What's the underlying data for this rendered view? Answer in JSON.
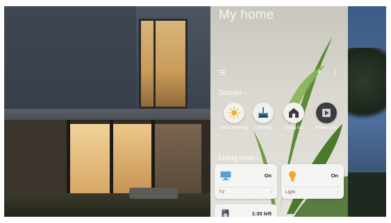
{
  "app": {
    "title": "My home"
  },
  "toolbar": {
    "menu_icon": "menu-icon",
    "add_icon": "plus-icon",
    "add_label": "+",
    "more_icon": "more-vertical-icon"
  },
  "scenes": {
    "label": "Scenes",
    "chevron": "›",
    "items": [
      {
        "label": "Good morning",
        "icon": "sun-icon"
      },
      {
        "label": "Cleaning",
        "icon": "broom-icon"
      },
      {
        "label": "Going out",
        "icon": "house-icon"
      },
      {
        "label": "Movie time",
        "icon": "play-icon"
      }
    ]
  },
  "rooms": {
    "label": "Living room",
    "chevron": "›"
  },
  "devices": [
    {
      "name": "TV",
      "state": "On",
      "icon": "tv-icon",
      "arrow": "›"
    },
    {
      "name": "Light",
      "state": "On",
      "icon": "lightbulb-icon",
      "arrow": "›"
    },
    {
      "name": "",
      "state": "1:30 left",
      "icon": "washer-icon"
    }
  ],
  "colors": {
    "bulb_accent": "#f5a623",
    "tv_accent": "#4a90c8",
    "dark_scene": "#3d3d40"
  }
}
